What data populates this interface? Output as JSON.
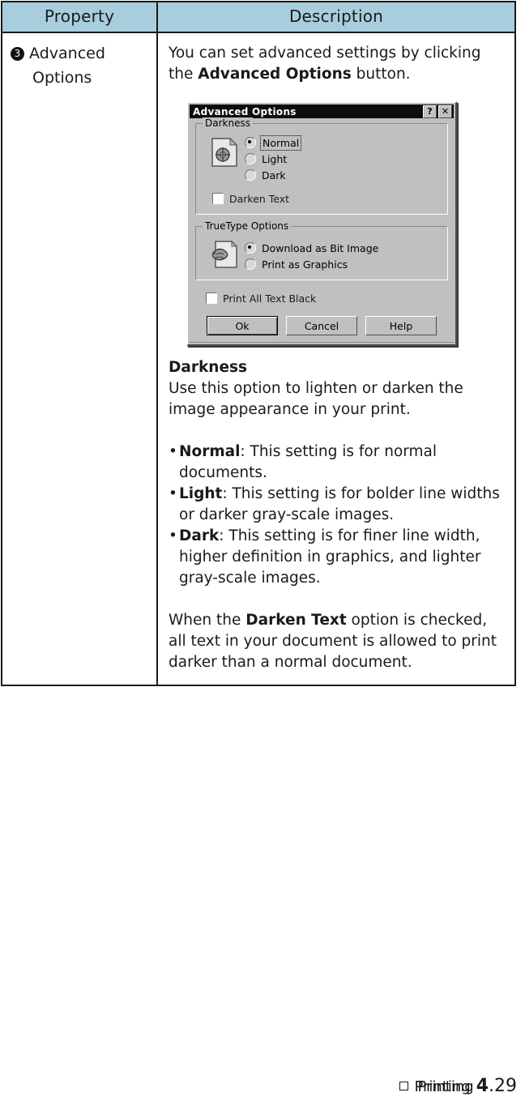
{
  "table": {
    "headers": {
      "property": "Property",
      "description": "Description"
    },
    "row": {
      "property": {
        "number": "3",
        "line1": "Advanced",
        "line2": "Options"
      },
      "description": {
        "intro_before": "You can set advanced settings by clicking the ",
        "intro_bold": "Advanced Options",
        "intro_after": " button.",
        "section_title": "Darkness",
        "section_body": "Use this option to lighten or darken the image appearance in your print.",
        "bullets": [
          {
            "dot": "•",
            "bold": "Normal",
            "rest": ": This setting is for normal documents."
          },
          {
            "dot": "•",
            "bold": "Light",
            "rest": ": This setting is for bolder line  widths or darker gray-scale images."
          },
          {
            "dot": "•",
            "bold": "Dark",
            "rest": ": This setting is for finer line width, higher definition in graphics, and lighter gray-scale images."
          }
        ],
        "closing_before": "When the ",
        "closing_bold": "Darken Text",
        "closing_after": " option is checked, all text in your document is allowed to print darker than a normal document."
      }
    }
  },
  "dialog": {
    "title": "Advanced Options",
    "help_button": "?",
    "close_button": "✕",
    "groups": [
      {
        "label": "Darkness",
        "icon": "page-darkness-icon",
        "options": [
          {
            "label": "Normal",
            "type": "radio",
            "selected": true,
            "focused": true
          },
          {
            "label": "Light",
            "type": "radio",
            "selected": false,
            "focused": false
          },
          {
            "label": "Dark",
            "type": "radio",
            "selected": false,
            "focused": false
          }
        ],
        "checkbox": {
          "label": "Darken Text",
          "checked": false
        }
      },
      {
        "label": "TrueType Options",
        "icon": "page-truetype-icon",
        "options": [
          {
            "label": "Download as Bit Image",
            "type": "radio",
            "selected": true,
            "focused": false
          },
          {
            "label": "Print as Graphics",
            "type": "radio",
            "selected": false,
            "focused": false
          }
        ]
      }
    ],
    "standalone_checkbox": {
      "label": "Print All Text Black",
      "checked": false
    },
    "buttons": [
      {
        "label": "Ok",
        "default": true
      },
      {
        "label": "Cancel",
        "default": false
      },
      {
        "label": "Help",
        "default": false
      }
    ]
  },
  "footer": {
    "section": "Printing",
    "page_major": "4",
    "page_minor": ".29"
  },
  "colors": {
    "header_fill": "#a8cddd",
    "border": "#1a1a1a",
    "dialog_face": "#c0c0c0",
    "dialog_titlebar": "#0d0d0d"
  }
}
